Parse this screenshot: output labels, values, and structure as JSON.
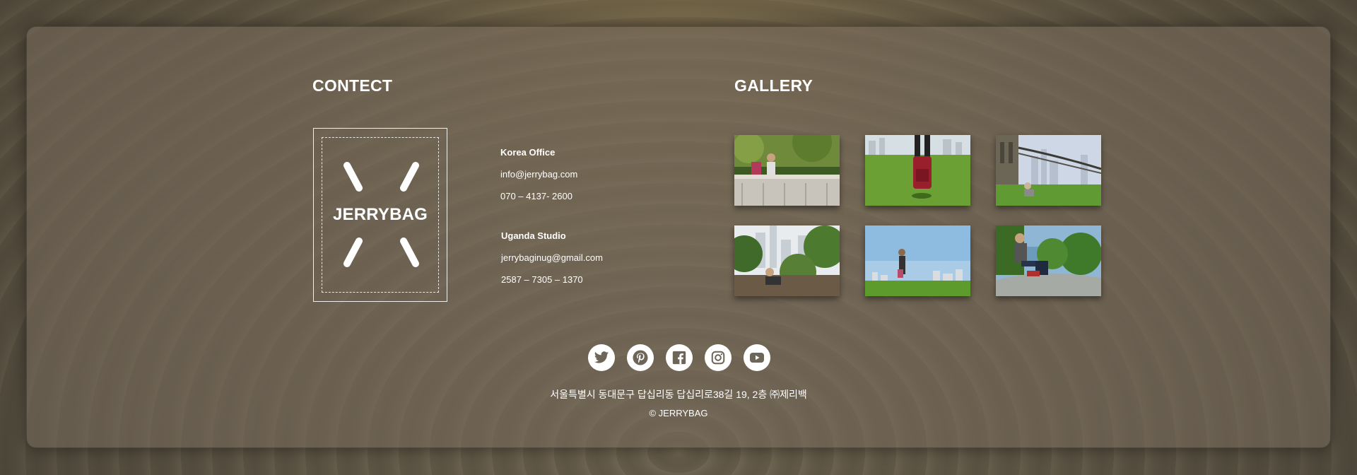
{
  "contact": {
    "heading": "CONTECT",
    "logo_text": "JERRYBAG",
    "offices": [
      {
        "title": "Korea Office",
        "email": "info@jerrybag.com",
        "phone": "070 – 4137- 2600"
      },
      {
        "title": "Uganda Studio",
        "email": "jerrybaginug@gmail.com",
        "phone": "2587 – 7305 – 1370"
      }
    ]
  },
  "gallery": {
    "heading": "GALLERY",
    "images": [
      {
        "name": "gallery-image-woman-on-wall"
      },
      {
        "name": "gallery-image-red-backpack"
      },
      {
        "name": "gallery-image-bridge-park"
      },
      {
        "name": "gallery-image-city-forest"
      },
      {
        "name": "gallery-image-skyline-hill"
      },
      {
        "name": "gallery-image-man-on-rock"
      }
    ]
  },
  "social": [
    {
      "icon": "twitter-icon"
    },
    {
      "icon": "pinterest-icon"
    },
    {
      "icon": "facebook-icon"
    },
    {
      "icon": "instagram-icon"
    },
    {
      "icon": "youtube-icon"
    }
  ],
  "footer": {
    "address": "서울특별시 동대문구 답십리동 답십리로38길 19, 2층 ㈜제리백",
    "copyright": "© JERRYBAG"
  },
  "colors": {
    "text": "#ffffff",
    "panel": "#786c5c"
  }
}
